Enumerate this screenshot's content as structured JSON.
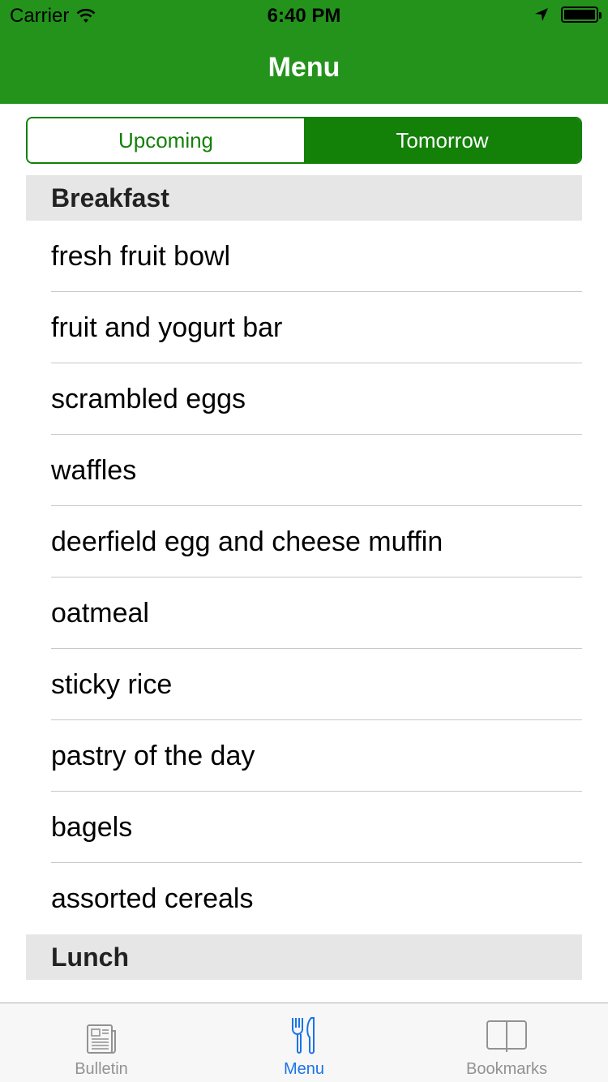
{
  "status_bar": {
    "carrier": "Carrier",
    "time": "6:40 PM"
  },
  "nav": {
    "title": "Menu"
  },
  "segments": [
    {
      "label": "Upcoming",
      "selected": false
    },
    {
      "label": "Tomorrow",
      "selected": true
    }
  ],
  "sections": [
    {
      "title": "Breakfast",
      "items": [
        "fresh fruit bowl",
        "fruit and yogurt bar",
        "scrambled eggs",
        "waffles",
        "deerfield egg and cheese muffin",
        "oatmeal",
        "sticky rice",
        "pastry of the day",
        "bagels",
        "assorted cereals"
      ]
    },
    {
      "title": "Lunch",
      "items": []
    }
  ],
  "tabbar": {
    "tabs": [
      {
        "label": "Bulletin",
        "icon": "newspaper-icon",
        "selected": false
      },
      {
        "label": "Menu",
        "icon": "fork-knife-icon",
        "selected": true
      },
      {
        "label": "Bookmarks",
        "icon": "book-icon",
        "selected": false
      }
    ]
  },
  "colors": {
    "nav_green": "#23931b",
    "segment_green": "#138008",
    "tab_selected": "#1a73e8",
    "tab_inactive": "#929292"
  }
}
